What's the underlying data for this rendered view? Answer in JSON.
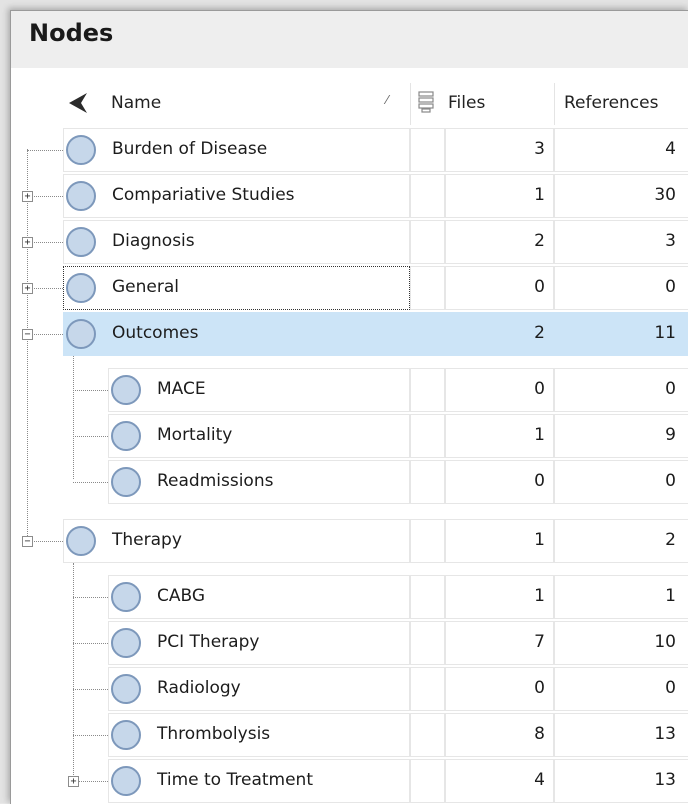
{
  "panel": {
    "title": "Nodes"
  },
  "columns": {
    "name": "Name",
    "files": "Files",
    "references": "References"
  },
  "rows": [
    {
      "name": "Burden of Disease",
      "files": "3",
      "refs": "4"
    },
    {
      "name": "Compariative Studies",
      "files": "1",
      "refs": "30"
    },
    {
      "name": "Diagnosis",
      "files": "2",
      "refs": "3"
    },
    {
      "name": "General",
      "files": "0",
      "refs": "0"
    },
    {
      "name": "Outcomes",
      "files": "2",
      "refs": "11"
    },
    {
      "name": "MACE",
      "files": "0",
      "refs": "0"
    },
    {
      "name": "Mortality",
      "files": "1",
      "refs": "9"
    },
    {
      "name": "Readmissions",
      "files": "0",
      "refs": "0"
    },
    {
      "name": "Therapy",
      "files": "1",
      "refs": "2"
    },
    {
      "name": "CABG",
      "files": "1",
      "refs": "1"
    },
    {
      "name": "PCI Therapy",
      "files": "7",
      "refs": "10"
    },
    {
      "name": "Radiology",
      "files": "0",
      "refs": "0"
    },
    {
      "name": "Thrombolysis",
      "files": "8",
      "refs": "13"
    },
    {
      "name": "Time to Treatment",
      "files": "4",
      "refs": "13"
    }
  ],
  "colors": {
    "selection": "#cce4f7",
    "node_fill": "#c6d7ea",
    "node_border": "#7d98bb"
  },
  "icons": {
    "header_star": "pin-icon",
    "header_files": "files-column-icon",
    "node": "node-circle-icon",
    "expand": "expand-icon",
    "collapse": "collapse-icon"
  }
}
